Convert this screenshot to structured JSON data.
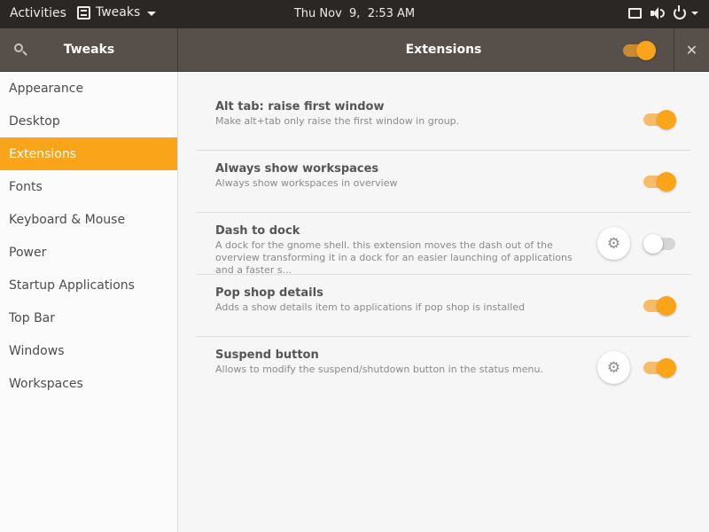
{
  "topbar": {
    "activities": "Activities",
    "app_name": "Tweaks",
    "clock": "Thu Nov  9,  2:53 AM"
  },
  "header": {
    "sidebar_title": "Tweaks",
    "title": "Extensions",
    "extensions_enabled": true,
    "close_glyph": "✕"
  },
  "sidebar": {
    "items": [
      {
        "label": "Appearance"
      },
      {
        "label": "Desktop"
      },
      {
        "label": "Extensions",
        "selected": true
      },
      {
        "label": "Fonts"
      },
      {
        "label": "Keyboard & Mouse"
      },
      {
        "label": "Power"
      },
      {
        "label": "Startup Applications"
      },
      {
        "label": "Top Bar"
      },
      {
        "label": "Windows"
      },
      {
        "label": "Workspaces"
      }
    ]
  },
  "extensions": [
    {
      "name": "Alt tab: raise first window",
      "description": "Make alt+tab only raise the first window in group.",
      "enabled": true,
      "has_settings": false
    },
    {
      "name": "Always show workspaces",
      "description": "Always show workspaces in overview",
      "enabled": true,
      "has_settings": false
    },
    {
      "name": "Dash to dock",
      "description": "A dock for the gnome shell. this extension moves the dash out of the overview transforming it in a dock for an easier launching of applications and a faster s...",
      "enabled": false,
      "has_settings": true
    },
    {
      "name": "Pop shop details",
      "description": "Adds a show details item to applications if pop shop is installed",
      "enabled": true,
      "has_settings": false
    },
    {
      "name": "Suspend button",
      "description": "Allows to modify the suspend/shutdown button in the status menu.",
      "enabled": true,
      "has_settings": true
    }
  ],
  "colors": {
    "accent": "#faa41a",
    "accent_track": "#f6bc6a",
    "topbar_bg": "#2b2725",
    "headerbar_bg": "#574f4a"
  },
  "icons": {
    "search": "search-icon",
    "close": "close-icon",
    "settings": "gear-icon",
    "app": "tweaks-app-icon",
    "display": "display-icon",
    "volume": "volume-icon",
    "power": "power-icon"
  },
  "gear_glyph": "⚙"
}
